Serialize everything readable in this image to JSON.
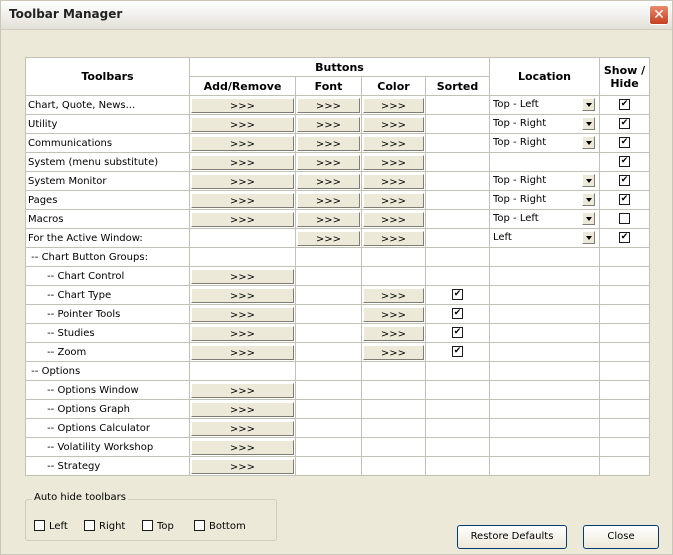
{
  "window": {
    "title": "Toolbar Manager"
  },
  "header": {
    "toolbars": "Toolbars",
    "buttons": "Buttons",
    "add_remove": "Add/Remove",
    "font": "Font",
    "color": "Color",
    "sorted": "Sorted",
    "location": "Location",
    "show_hide": "Show /\nHide"
  },
  "rows": [
    {
      "name": "Chart, Quote, News...",
      "add": ">>>",
      "font": ">>>",
      "color": ">>>",
      "location": "Top - Left",
      "show": true
    },
    {
      "name": "Utility",
      "add": ">>>",
      "font": ">>>",
      "color": ">>>",
      "location": "Top - Right",
      "show": true
    },
    {
      "name": "Communications",
      "add": ">>>",
      "font": ">>>",
      "color": ">>>",
      "location": "Top - Right",
      "show": true
    },
    {
      "name": "System (menu substitute)",
      "add": ">>>",
      "font": ">>>",
      "color": ">>>",
      "location": "",
      "show": true
    },
    {
      "name": "System Monitor",
      "add": ">>>",
      "font": ">>>",
      "color": ">>>",
      "location": "Top - Right",
      "show": true
    },
    {
      "name": "Pages",
      "add": ">>>",
      "font": ">>>",
      "color": ">>>",
      "location": "Top - Right",
      "show": true
    },
    {
      "name": "Macros",
      "add": ">>>",
      "font": ">>>",
      "color": ">>>",
      "location": "Top - Left",
      "show": false
    },
    {
      "name": "For the Active Window:",
      "add": "",
      "font": ">>>",
      "color": ">>>",
      "location": "Left",
      "show": true
    },
    {
      "name": " -- Chart Button Groups:"
    },
    {
      "name": "      -- Chart Control",
      "add": ">>>"
    },
    {
      "name": "      -- Chart Type",
      "add": ">>>",
      "color": ">>>",
      "sorted": true
    },
    {
      "name": "      -- Pointer Tools",
      "add": ">>>",
      "color": ">>>",
      "sorted": true
    },
    {
      "name": "      -- Studies",
      "add": ">>>",
      "color": ">>>",
      "sorted": true
    },
    {
      "name": "      -- Zoom",
      "add": ">>>",
      "color": ">>>",
      "sorted": true
    },
    {
      "name": " -- Options"
    },
    {
      "name": "      -- Options Window",
      "add": ">>>"
    },
    {
      "name": "      -- Options Graph",
      "add": ">>>"
    },
    {
      "name": "      -- Options Calculator",
      "add": ">>>"
    },
    {
      "name": "      -- Volatility Workshop",
      "add": ">>>"
    },
    {
      "name": "      -- Strategy",
      "add": ">>>"
    }
  ],
  "auto_hide": {
    "legend": "Auto hide toolbars",
    "options": [
      "Left",
      "Right",
      "Top",
      "Bottom"
    ]
  },
  "buttons": {
    "restore": "Restore Defaults",
    "close": "Close"
  }
}
